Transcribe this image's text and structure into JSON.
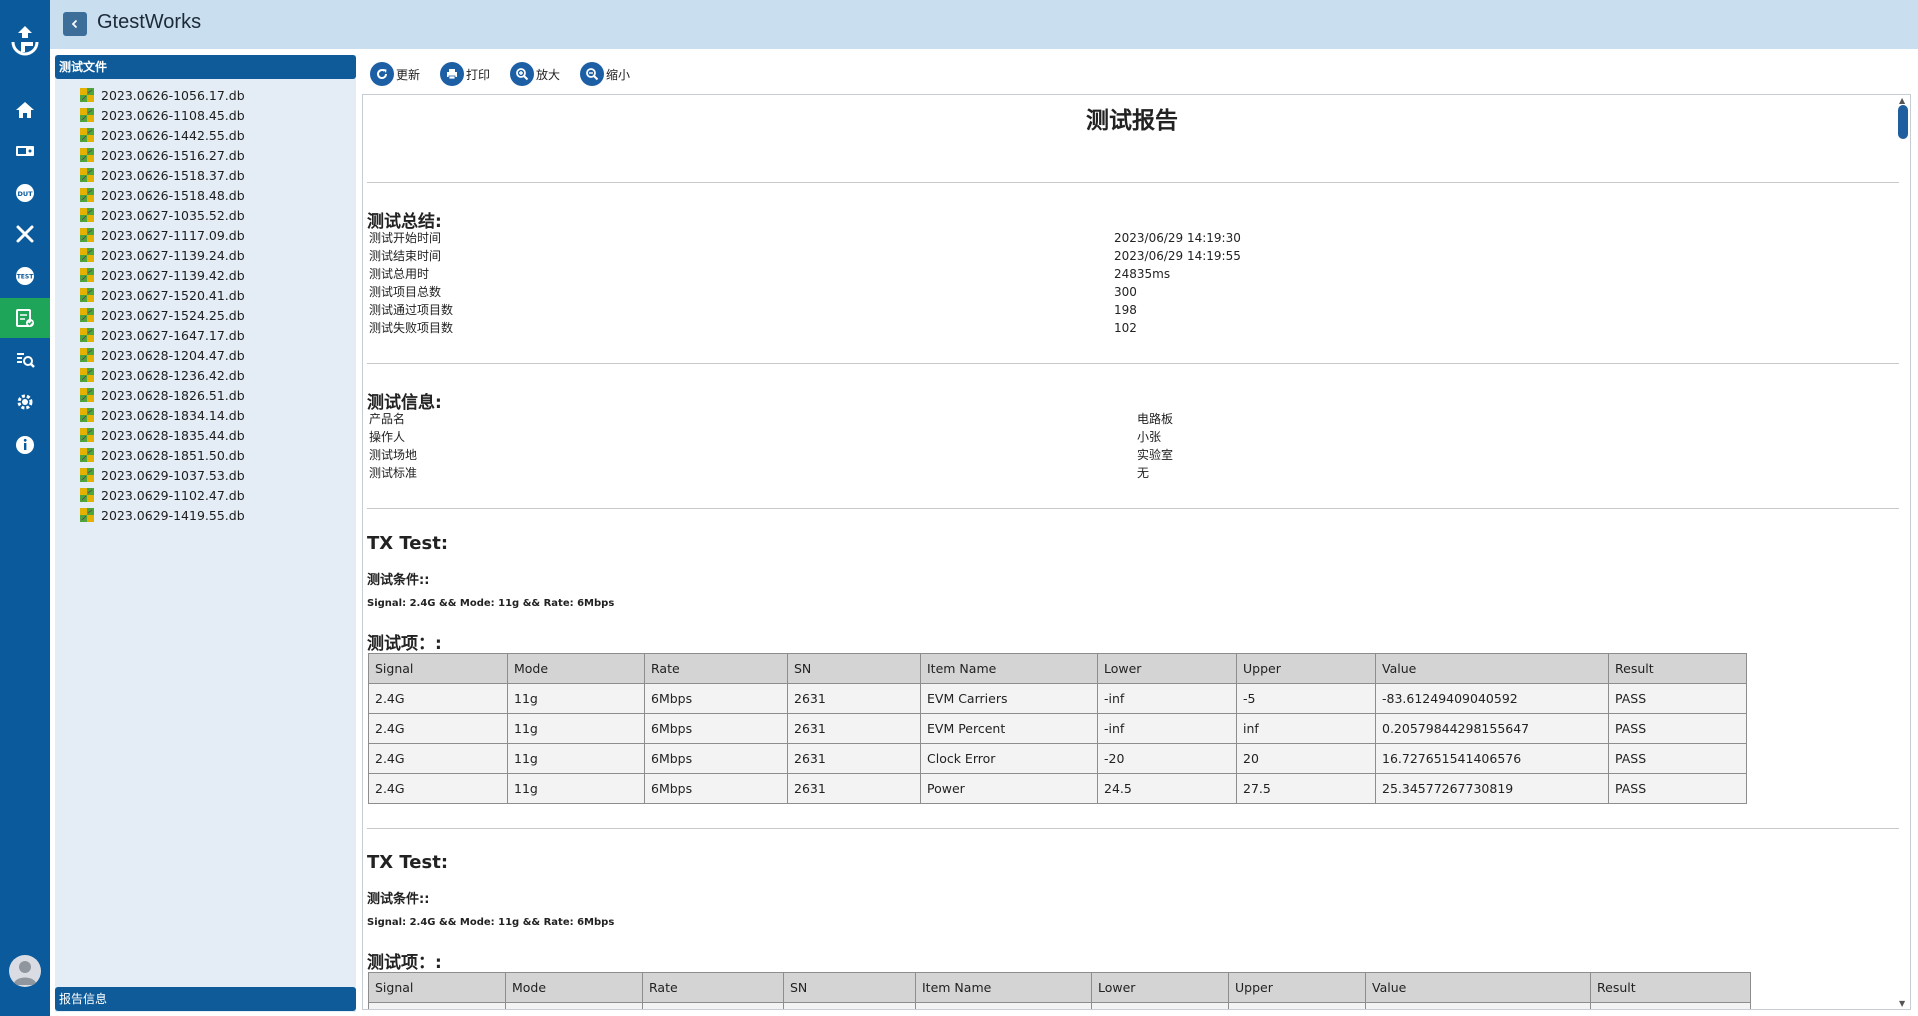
{
  "app": {
    "title": "GtestWorks"
  },
  "colors": {
    "rail": "#0a5a9c",
    "active_nav": "#1ea55a",
    "titlebar": "#c9deee",
    "panel_header": "#0f5b9a"
  },
  "sidebar_nav": [
    {
      "name": "home-icon",
      "active": false
    },
    {
      "name": "instrument-icon",
      "active": false
    },
    {
      "name": "dut-icon",
      "active": false
    },
    {
      "name": "tools-icon",
      "active": false
    },
    {
      "name": "test-icon",
      "active": false
    },
    {
      "name": "report-icon",
      "active": true
    },
    {
      "name": "search-data-icon",
      "active": false
    },
    {
      "name": "settings-icon",
      "active": false
    },
    {
      "name": "info-icon",
      "active": false
    }
  ],
  "file_panel": {
    "header": "测试文件",
    "footer": "报告信息",
    "files": [
      "2023.0626-1056.17.db",
      "2023.0626-1108.45.db",
      "2023.0626-1442.55.db",
      "2023.0626-1516.27.db",
      "2023.0626-1518.37.db",
      "2023.0626-1518.48.db",
      "2023.0627-1035.52.db",
      "2023.0627-1117.09.db",
      "2023.0627-1139.24.db",
      "2023.0627-1139.42.db",
      "2023.0627-1520.41.db",
      "2023.0627-1524.25.db",
      "2023.0627-1647.17.db",
      "2023.0628-1204.47.db",
      "2023.0628-1236.42.db",
      "2023.0628-1826.51.db",
      "2023.0628-1834.14.db",
      "2023.0628-1835.44.db",
      "2023.0628-1851.50.db",
      "2023.0629-1037.53.db",
      "2023.0629-1102.47.db",
      "2023.0629-1419.55.db"
    ]
  },
  "toolbar": {
    "refresh": "更新",
    "print": "打印",
    "zoom_in": "放大",
    "zoom_out": "缩小"
  },
  "report": {
    "title": "测试报告",
    "summary": {
      "heading": "测试总结:",
      "rows": [
        {
          "key": "测试开始时间",
          "value": "2023/06/29 14:19:30"
        },
        {
          "key": "测试结束时间",
          "value": "2023/06/29 14:19:55"
        },
        {
          "key": "测试总用时",
          "value": "24835ms"
        },
        {
          "key": "测试项目总数",
          "value": "300"
        },
        {
          "key": "测试通过项目数",
          "value": "198"
        },
        {
          "key": "测试失败项目数",
          "value": "102"
        }
      ]
    },
    "info": {
      "heading": "测试信息:",
      "rows": [
        {
          "key": "产品名",
          "value": "电路板"
        },
        {
          "key": "操作人",
          "value": "小张"
        },
        {
          "key": "测试场地",
          "value": "实验室"
        },
        {
          "key": "测试标准",
          "value": "无"
        }
      ]
    },
    "sections": [
      {
        "heading": "TX Test:",
        "condition_label": "测试条件::",
        "condition": "Signal: 2.4G && Mode: 11g && Rate: 6Mbps",
        "items_label": "测试项：:",
        "columns": [
          "Signal",
          "Mode",
          "Rate",
          "SN",
          "Item Name",
          "Lower",
          "Upper",
          "Value",
          "Result"
        ],
        "rows": [
          [
            "2.4G",
            "11g",
            "6Mbps",
            "2631",
            "EVM Carriers",
            "-inf",
            "-5",
            "-83.61249409040592",
            "PASS"
          ],
          [
            "2.4G",
            "11g",
            "6Mbps",
            "2631",
            "EVM Percent",
            "-inf",
            "inf",
            "0.20579844298155647",
            "PASS"
          ],
          [
            "2.4G",
            "11g",
            "6Mbps",
            "2631",
            "Clock Error",
            "-20",
            "20",
            "16.727651541406576",
            "PASS"
          ],
          [
            "2.4G",
            "11g",
            "6Mbps",
            "2631",
            "Power",
            "24.5",
            "27.5",
            "25.34577267730819",
            "PASS"
          ]
        ]
      },
      {
        "heading": "TX Test:",
        "condition_label": "测试条件::",
        "condition": "Signal: 2.4G && Mode: 11g && Rate: 6Mbps",
        "items_label": "测试项：:",
        "columns": [
          "Signal",
          "Mode",
          "Rate",
          "SN",
          "Item Name",
          "Lower",
          "Upper",
          "Value",
          "Result"
        ],
        "rows": []
      }
    ]
  }
}
